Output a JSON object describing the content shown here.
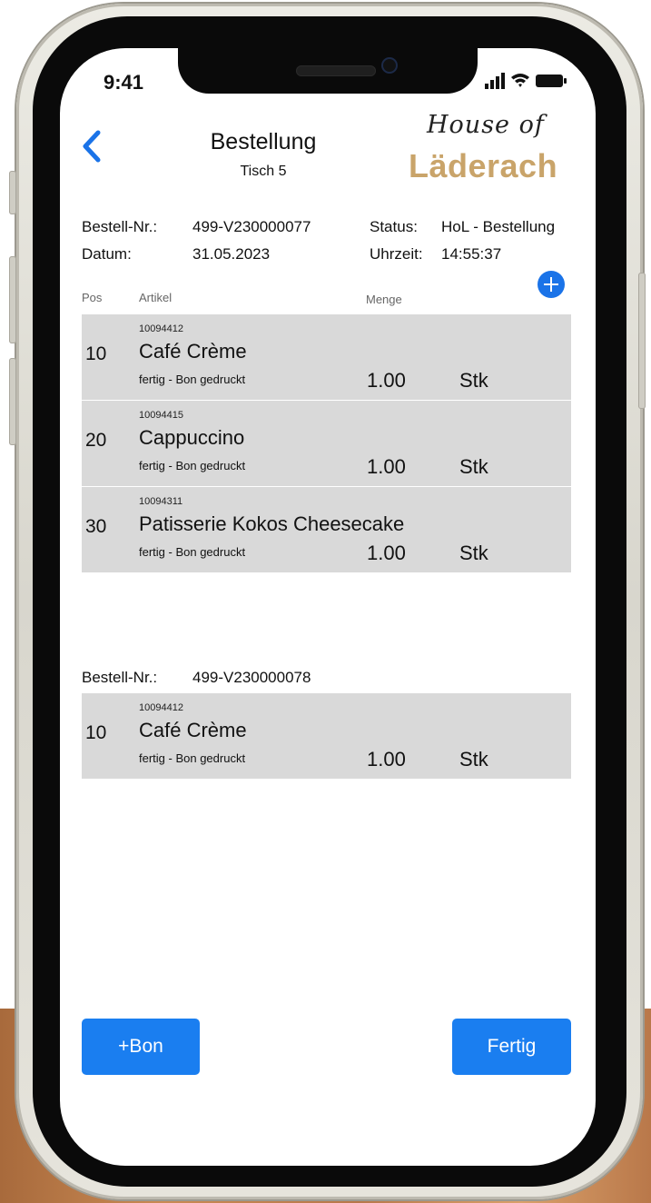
{
  "status_bar": {
    "time": "9:41"
  },
  "header": {
    "back_icon": "chevron-left-icon",
    "title": "Bestellung",
    "subtitle": "Tisch 5",
    "logo_line1": "House of",
    "logo_line2": "Läderach",
    "logo_color": "#c9a46a"
  },
  "order1": {
    "number_label": "Bestell-Nr.:",
    "number": "499-V230000077",
    "date_label": "Datum:",
    "date": "31.05.2023",
    "status_label": "Status:",
    "status": "HoL - Bestellung",
    "time_label": "Uhrzeit:",
    "time": "14:55:37"
  },
  "columns": {
    "pos": "Pos",
    "artikel": "Artikel",
    "menge": "Menge"
  },
  "items1": [
    {
      "pos": "10",
      "code": "10094412",
      "name": "Café Crème",
      "state": "fertig - Bon gedruckt",
      "qty": "1.00",
      "unit": "Stk"
    },
    {
      "pos": "20",
      "code": "10094415",
      "name": "Cappuccino",
      "state": "fertig - Bon gedruckt",
      "qty": "1.00",
      "unit": "Stk"
    },
    {
      "pos": "30",
      "code": "10094311",
      "name": "Patisserie Kokos Cheesecake",
      "state": "fertig - Bon gedruckt",
      "qty": "1.00",
      "unit": "Stk"
    }
  ],
  "order2": {
    "number_label": "Bestell-Nr.:",
    "number": "499-V230000078"
  },
  "items2": [
    {
      "pos": "10",
      "code": "10094412",
      "name": "Café Crème",
      "state": "fertig - Bon gedruckt",
      "qty": "1.00",
      "unit": "Stk"
    }
  ],
  "buttons": {
    "add_bon": "+Bon",
    "done": "Fertig"
  },
  "accent_color": "#1a73e8"
}
